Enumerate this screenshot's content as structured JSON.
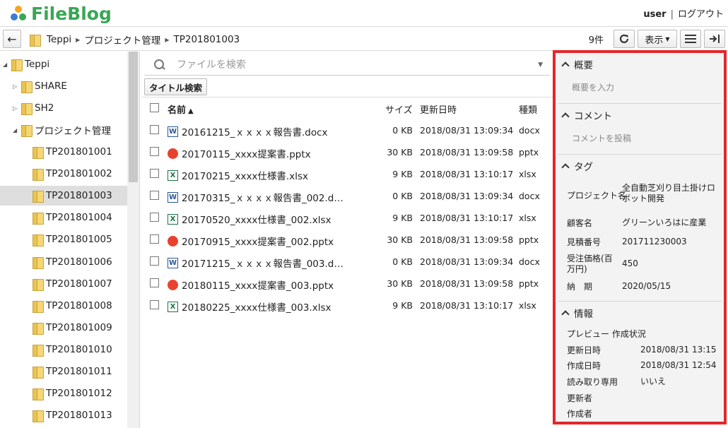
{
  "app": {
    "name": "FileBlog"
  },
  "header": {
    "user": "user",
    "separator": "|",
    "logout": "ログアウト"
  },
  "toolbar": {
    "breadcrumb": [
      "Teppi",
      "プロジェクト管理",
      "TP201801003"
    ],
    "count": "9件",
    "view_label": "表示"
  },
  "tree": [
    {
      "label": "Teppi",
      "toggle": "◢",
      "level": 0
    },
    {
      "label": "SHARE",
      "toggle": "▷",
      "level": 1
    },
    {
      "label": "SH2",
      "toggle": "▷",
      "level": 1
    },
    {
      "label": "プロジェクト管理",
      "toggle": "◢",
      "level": 1
    },
    {
      "label": "TP201801001",
      "toggle": "",
      "level": 2
    },
    {
      "label": "TP201801002",
      "toggle": "",
      "level": 2
    },
    {
      "label": "TP201801003",
      "toggle": "",
      "level": 2,
      "selected": true
    },
    {
      "label": "TP201801004",
      "toggle": "",
      "level": 2
    },
    {
      "label": "TP201801005",
      "toggle": "",
      "level": 2
    },
    {
      "label": "TP201801006",
      "toggle": "",
      "level": 2
    },
    {
      "label": "TP201801007",
      "toggle": "",
      "level": 2
    },
    {
      "label": "TP201801008",
      "toggle": "",
      "level": 2
    },
    {
      "label": "TP201801009",
      "toggle": "",
      "level": 2
    },
    {
      "label": "TP201801010",
      "toggle": "",
      "level": 2
    },
    {
      "label": "TP201801011",
      "toggle": "",
      "level": 2
    },
    {
      "label": "TP201801012",
      "toggle": "",
      "level": 2
    },
    {
      "label": "TP201801013",
      "toggle": "",
      "level": 2
    }
  ],
  "search": {
    "placeholder": "ファイルを検索"
  },
  "title_search_label": "タイトル検索",
  "columns": {
    "name": "名前",
    "sort_indicator": "▲",
    "size": "サイズ",
    "updated": "更新日時",
    "type": "種類"
  },
  "files": [
    {
      "name": "20161215_ｘｘｘｘ報告書.docx",
      "size": "0 KB",
      "updated": "2018/08/31 13:09:34",
      "type": "docx"
    },
    {
      "name": "20170115_xxxx提案書.pptx",
      "size": "30 KB",
      "updated": "2018/08/31 13:09:58",
      "type": "pptx"
    },
    {
      "name": "20170215_xxxx仕様書.xlsx",
      "size": "9 KB",
      "updated": "2018/08/31 13:10:17",
      "type": "xlsx"
    },
    {
      "name": "20170315_ｘｘｘｘ報告書_002.d…",
      "size": "0 KB",
      "updated": "2018/08/31 13:09:34",
      "type": "docx"
    },
    {
      "name": "20170520_xxxx仕様書_002.xlsx",
      "size": "9 KB",
      "updated": "2018/08/31 13:10:17",
      "type": "xlsx"
    },
    {
      "name": "20170915_xxxx提案書_002.pptx",
      "size": "30 KB",
      "updated": "2018/08/31 13:09:58",
      "type": "pptx"
    },
    {
      "name": "20171215_ｘｘｘｘ報告書_003.d…",
      "size": "0 KB",
      "updated": "2018/08/31 13:09:34",
      "type": "docx"
    },
    {
      "name": "20180115_xxxx提案書_003.pptx",
      "size": "30 KB",
      "updated": "2018/08/31 13:09:58",
      "type": "pptx"
    },
    {
      "name": "20180225_xxxx仕様書_003.xlsx",
      "size": "9 KB",
      "updated": "2018/08/31 13:10:17",
      "type": "xlsx"
    }
  ],
  "panel": {
    "overview": {
      "title": "概要",
      "hint": "概要を入力"
    },
    "comment": {
      "title": "コメント",
      "hint": "コメントを投稿"
    },
    "tags": {
      "title": "タグ",
      "items": [
        {
          "label": "プロジェクト名",
          "value": "全自動芝刈り目土掛けロボット開発"
        },
        {
          "label": "顧客名",
          "value": "グリーンいろはに産業"
        },
        {
          "label": "見積番号",
          "value": "201711230003"
        },
        {
          "label": "受注価格(百万円)",
          "value": "450"
        },
        {
          "label": "納　期",
          "value": "2020/05/15"
        }
      ]
    },
    "info": {
      "title": "情報",
      "items": [
        {
          "label": "プレビュー 作成状況",
          "value": ""
        },
        {
          "label": "更新日時",
          "value": "2018/08/31 13:15"
        },
        {
          "label": "作成日時",
          "value": "2018/08/31 12:54"
        },
        {
          "label": "読み取り専用",
          "value": "いいえ"
        },
        {
          "label": "更新者",
          "value": ""
        },
        {
          "label": "作成者",
          "value": ""
        }
      ]
    }
  },
  "colors": {
    "brand": "#3aa655",
    "highlight_border": "#e5262a",
    "selected_row": "#dedede"
  }
}
